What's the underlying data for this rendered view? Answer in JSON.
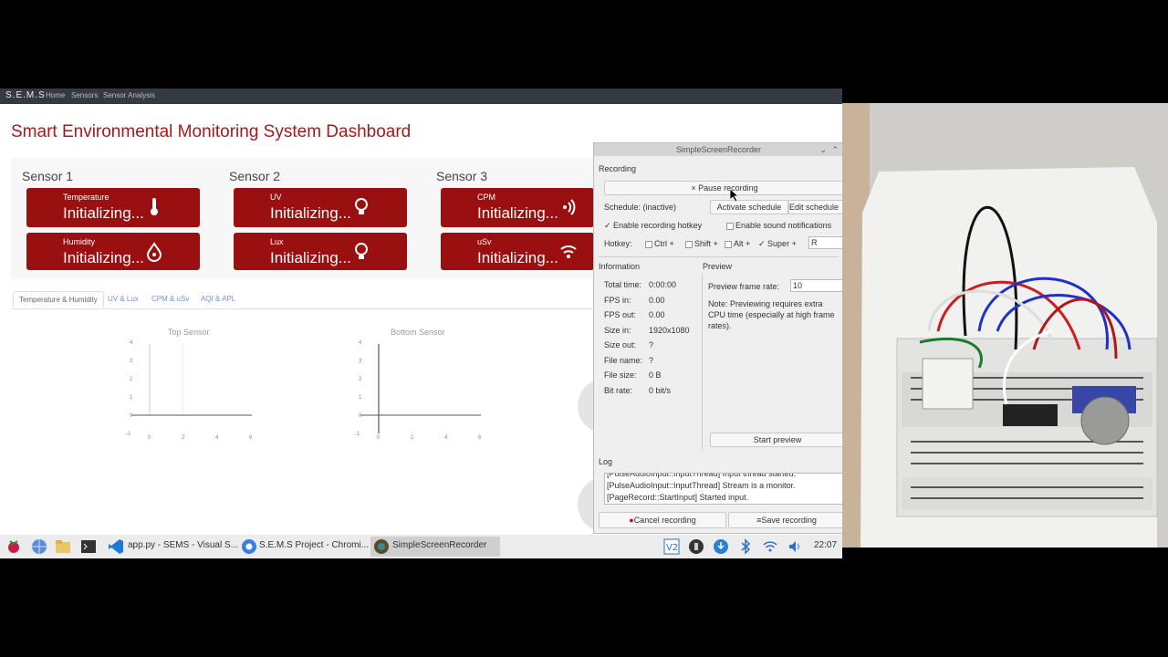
{
  "nav": {
    "brand": "S.E.M.S",
    "links": [
      "Home",
      "Sensors",
      "Sensor Analysis"
    ]
  },
  "page_title": "Smart Environmental Monitoring System Dashboard",
  "sensors": [
    {
      "title": "Sensor 1",
      "cards": [
        {
          "label": "Temperature",
          "value": "Initializing...",
          "icon": "thermometer-icon"
        },
        {
          "label": "Humidity",
          "value": "Initializing...",
          "icon": "droplet-icon"
        }
      ]
    },
    {
      "title": "Sensor 2",
      "cards": [
        {
          "label": "UV",
          "value": "Initializing...",
          "icon": "lightbulb-icon"
        },
        {
          "label": "Lux",
          "value": "Initializing...",
          "icon": "lightbulb-icon"
        }
      ]
    },
    {
      "title": "Sensor 3",
      "cards": [
        {
          "label": "CPM",
          "value": "Initializing...",
          "icon": "radiation-waves-icon"
        },
        {
          "label": "uSv",
          "value": "Initializing...",
          "icon": "signal-icon"
        }
      ]
    }
  ],
  "tabs": [
    "Temperature & Humidity",
    "UV & Lux",
    "CPM & uSv",
    "AQI & APL"
  ],
  "charts": {
    "top_title": "Top Sensor",
    "bottom_title": "Bottom Sensor",
    "y_ticks": [
      "4",
      "3",
      "2",
      "1",
      "0",
      "-1"
    ],
    "x_ticks": [
      "0",
      "2",
      "4",
      "6"
    ]
  },
  "chart_data": [
    {
      "type": "line",
      "title": "Top Sensor",
      "xlabel": "",
      "ylabel": "",
      "xlim": [
        0,
        6
      ],
      "ylim": [
        -1,
        4
      ],
      "series": []
    },
    {
      "type": "line",
      "title": "Bottom Sensor",
      "xlabel": "",
      "ylabel": "",
      "xlim": [
        0,
        6
      ],
      "ylim": [
        -1,
        4
      ],
      "series": []
    }
  ],
  "recorder": {
    "title": "SimpleScreenRecorder",
    "recording_label": "Recording",
    "pause_btn": "Pause recording",
    "schedule": "Schedule: (inactive)",
    "activate_schedule": "Activate schedule",
    "edit_schedule": "Edit schedule",
    "enable_hotkey": "Enable recording hotkey",
    "enable_sound": "Enable sound notifications",
    "hotkey_label": "Hotkey:",
    "mods": [
      "Ctrl +",
      "Shift +",
      "Alt +",
      "Super +"
    ],
    "key": "R",
    "information_label": "Information",
    "info": [
      {
        "k": "Total time:",
        "v": "0:00:00"
      },
      {
        "k": "FPS in:",
        "v": "0.00"
      },
      {
        "k": "FPS out:",
        "v": "0.00"
      },
      {
        "k": "Size in:",
        "v": "1920x1080"
      },
      {
        "k": "Size out:",
        "v": "?"
      },
      {
        "k": "File name:",
        "v": "?"
      },
      {
        "k": "File size:",
        "v": "0 B"
      },
      {
        "k": "Bit rate:",
        "v": "0 bit/s"
      }
    ],
    "preview_label": "Preview",
    "preview_rate_label": "Preview frame rate:",
    "preview_rate": "10",
    "preview_note": "Note: Previewing requires extra CPU time (especially at high frame rates).",
    "start_preview": "Start preview",
    "log_label": "Log",
    "log_lines": [
      "[PulseAudioInput::InputThread] Input thread started.",
      "[PulseAudioInput::InputThread] Stream is a monitor.",
      "[PageRecord::StartInput] Started input."
    ],
    "cancel_btn": "Cancel recording",
    "save_btn": "Save recording"
  },
  "taskbar": {
    "items": [
      "app.py - SEMS - Visual S...",
      "S.E.M.S Project - Chromi...",
      "SimpleScreenRecorder"
    ],
    "time": "22:07"
  },
  "colors": {
    "card": "#9a0f0f",
    "title": "#a21b1b",
    "tab_link": "#7a8be0"
  }
}
